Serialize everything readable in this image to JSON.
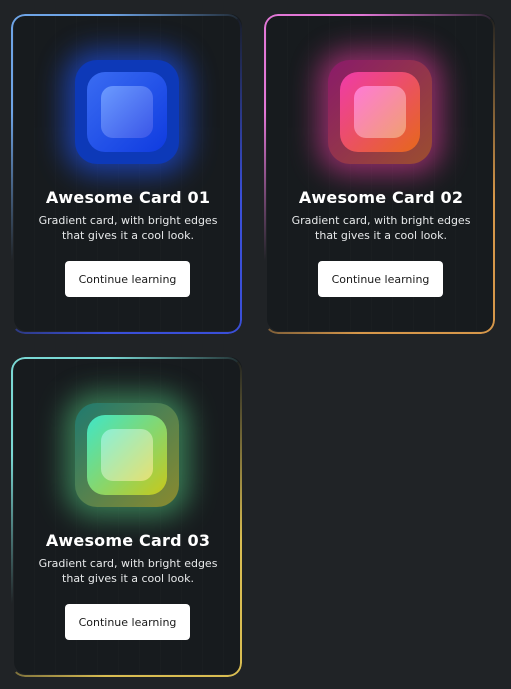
{
  "cards": [
    {
      "title": "Awesome Card 01",
      "description": "Gradient card, with bright edges that gives it a cool look.",
      "button_label": "Continue learning",
      "icon": "rounded-square-blue-icon",
      "accent_colors": [
        "#6ea4e6",
        "#3a4fd8"
      ]
    },
    {
      "title": "Awesome Card 02",
      "description": "Gradient card, with bright edges that gives it a cool look.",
      "button_label": "Continue learning",
      "icon": "rounded-square-pink-icon",
      "accent_colors": [
        "#e277d6",
        "#d6974a"
      ]
    },
    {
      "title": "Awesome Card 03",
      "description": "Gradient card, with bright edges that gives it a cool look.",
      "button_label": "Continue learning",
      "icon": "rounded-square-teal-icon",
      "accent_colors": [
        "#7ad8d4",
        "#d9bd52"
      ]
    }
  ],
  "colors": {
    "background": "#202326",
    "card_panel": "#171b1e",
    "button_background": "#ffffff",
    "title_text": "#ffffff"
  }
}
